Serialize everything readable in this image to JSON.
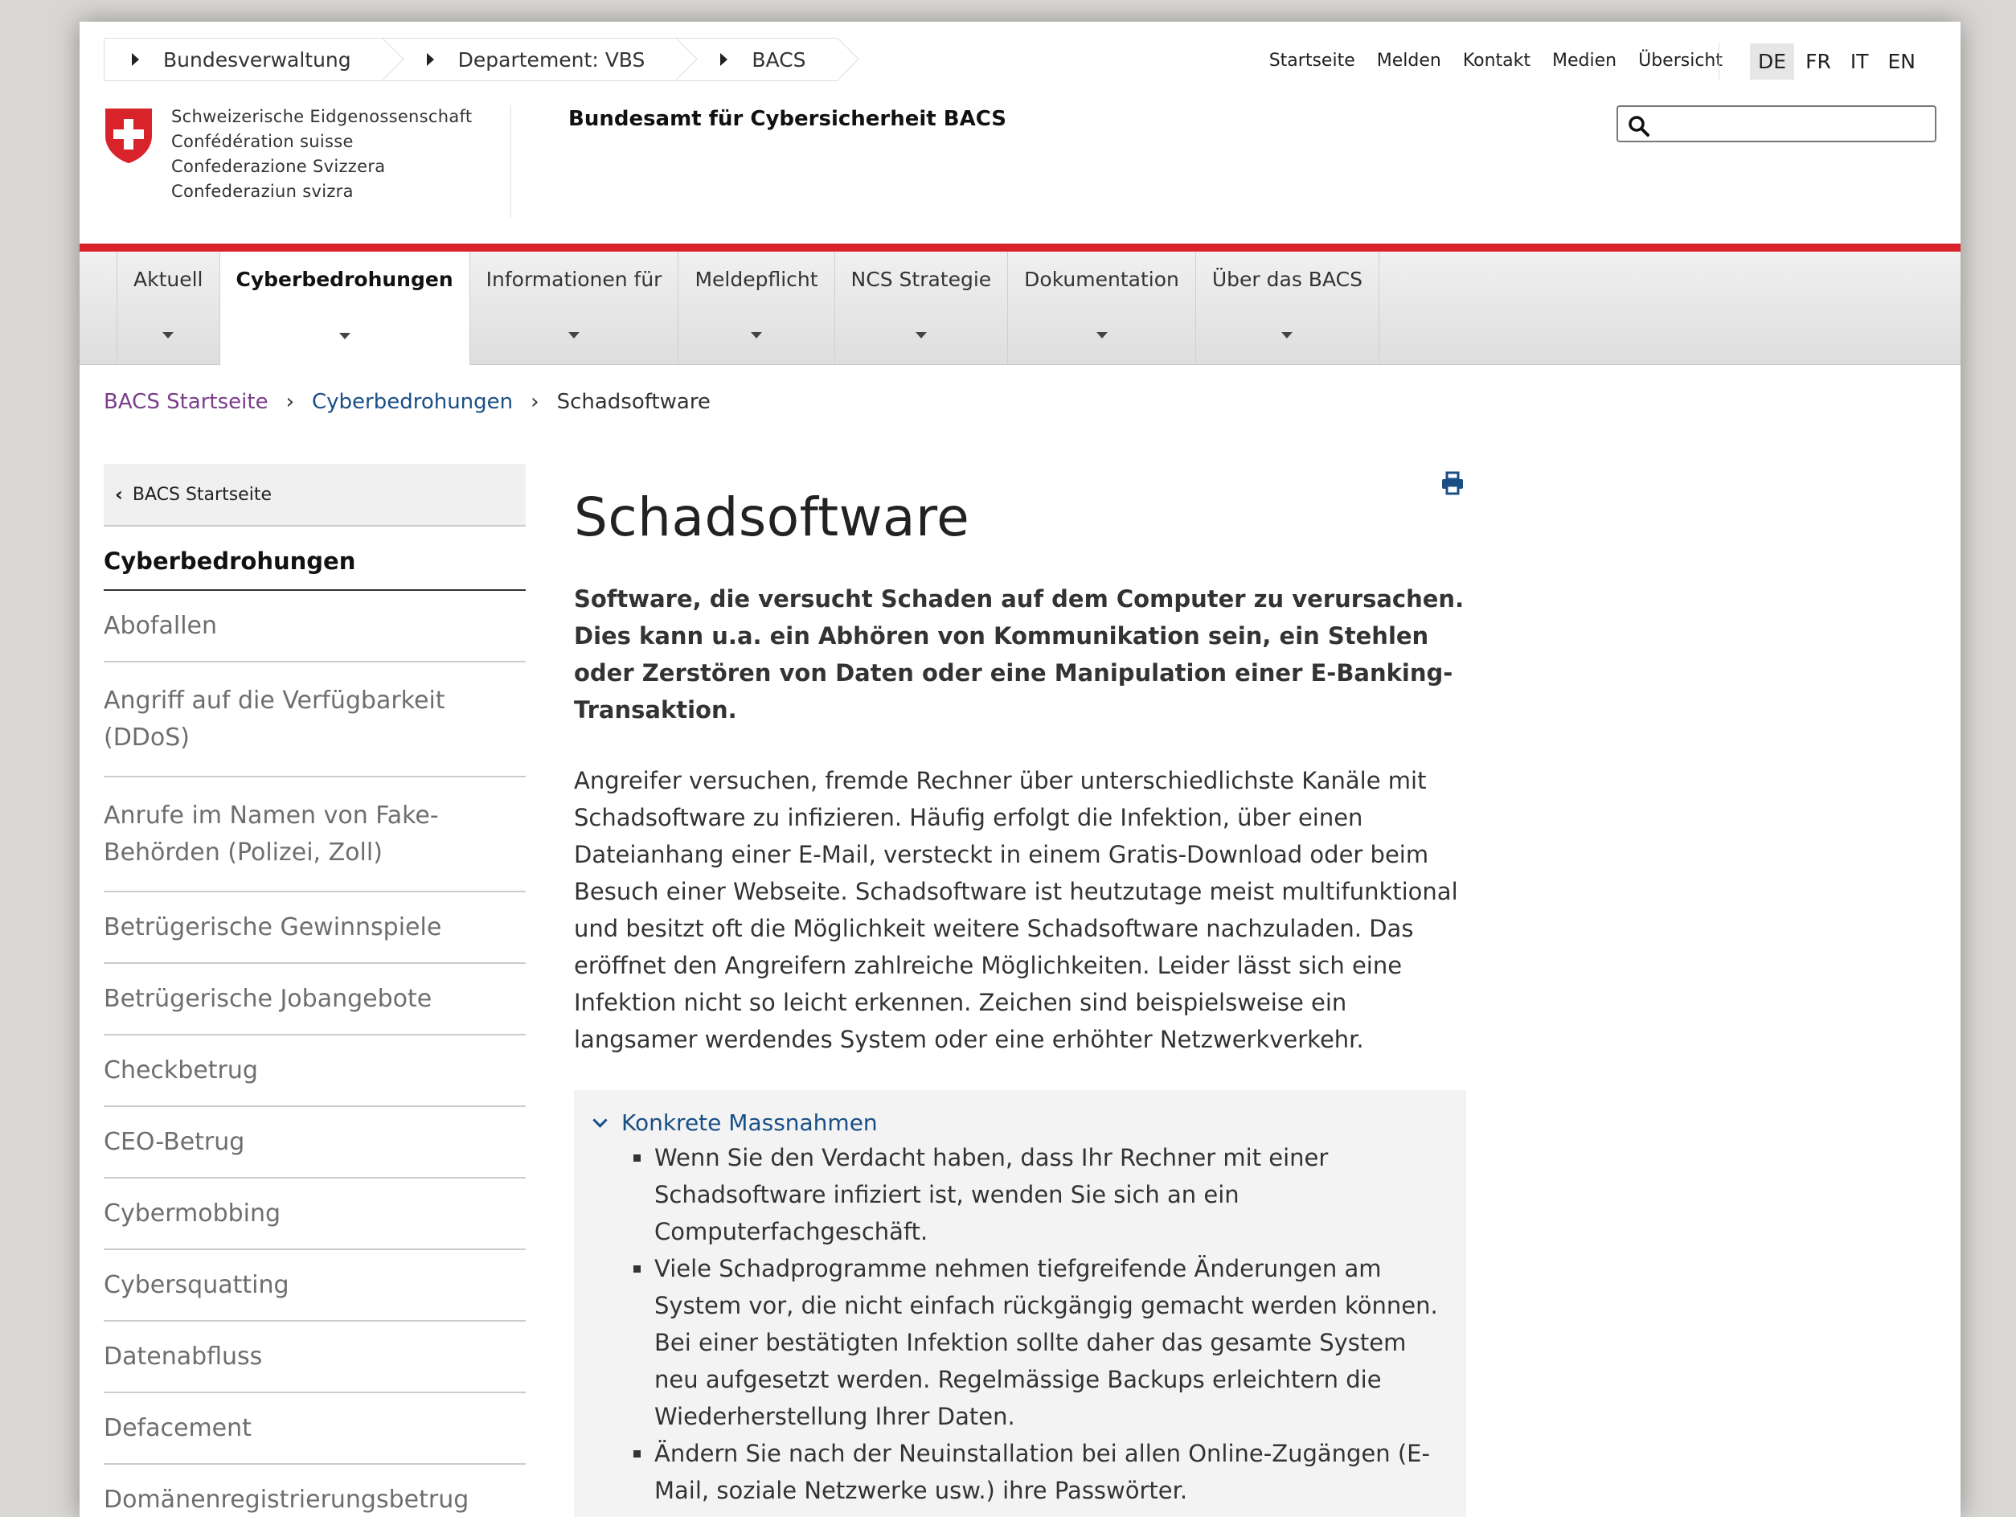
{
  "top_breadcrumbs": [
    "Bundesverwaltung",
    "Departement: VBS",
    "BACS"
  ],
  "top_links": [
    "Startseite",
    "Melden",
    "Kontakt",
    "Medien",
    "Übersicht"
  ],
  "languages": [
    "DE",
    "FR",
    "IT",
    "EN"
  ],
  "active_language": "DE",
  "search": {
    "placeholder": ""
  },
  "logo_lines": [
    "Schweizerische Eidgenossenschaft",
    "Confédération suisse",
    "Confederazione Svizzera",
    "Confederaziun svizra"
  ],
  "office_name": "Bundesamt für Cybersicherheit BACS",
  "main_nav": [
    "Aktuell",
    "Cyberbedrohungen",
    "Informationen für",
    "Meldepflicht",
    "NCS Strategie",
    "Dokumentation",
    "Über das BACS"
  ],
  "main_nav_active": "Cyberbedrohungen",
  "breadcrumb": {
    "home": "BACS Startseite",
    "parent": "Cyberbedrohungen",
    "current": "Schadsoftware"
  },
  "sidebar": {
    "back": "BACS Startseite",
    "title": "Cyberbedrohungen",
    "items": [
      "Abofallen",
      "Angriff auf die Verfügbarkeit (DDoS)",
      "Anrufe im Namen von Fake-Behörden (Polizei, Zoll)",
      "Betrügerische Gewinnspiele",
      "Betrügerische Jobangebote",
      "Checkbetrug",
      "CEO-Betrug",
      "Cybermobbing",
      "Cybersquatting",
      "Datenabfluss",
      "Defacement",
      "Domänenregistrierungsbetrug"
    ]
  },
  "article": {
    "title": "Schadsoftware",
    "lead": "Software, die versucht Schaden auf dem Computer zu verursachen. Dies kann u.a. ein Abhören von Kommunikation sein, ein Stehlen oder Zerstören von Daten oder eine Manipulation einer E-Banking-Transaktion.",
    "body": "Angreifer versuchen, fremde Rechner über unterschiedlichste Kanäle mit Schadsoftware zu infizieren. Häufig erfolgt die Infektion, über einen Dateianhang einer E-Mail, versteckt in einem Gratis-Download oder beim Besuch einer Webseite. Schadsoftware ist heutzutage meist multifunktional und besitzt oft die Möglichkeit weitere Schadsoftware nachzuladen. Das eröffnet den Angreifern zahlreiche Möglichkeiten. Leider lässt sich eine Infektion nicht so leicht erkennen. Zeichen sind beispielsweise ein langsamer werdendes System oder eine erhöhter Netzwerkverkehr.",
    "accordion": {
      "title": "Konkrete Massnahmen",
      "items": [
        "Wenn Sie den Verdacht haben, dass Ihr Rechner mit einer Schadsoftware infiziert ist, wenden Sie sich an ein Computerfachgeschäft.",
        "Viele Schadprogramme nehmen tiefgreifende Änderungen am System vor, die nicht einfach rückgängig gemacht werden können. Bei einer bestätigten Infektion sollte daher das gesamte System neu aufgesetzt werden. Regelmässige Backups erleichtern die Wiederherstellung Ihrer Daten.",
        "Ändern Sie nach der Neuinstallation bei allen Online-Zugängen (E-Mail, soziale Netzwerke usw.) ihre Passwörter."
      ]
    }
  },
  "colors": {
    "swiss_red": "#d8232a",
    "link_blue": "#1a4f86",
    "visited_purple": "#7a3e8a"
  }
}
